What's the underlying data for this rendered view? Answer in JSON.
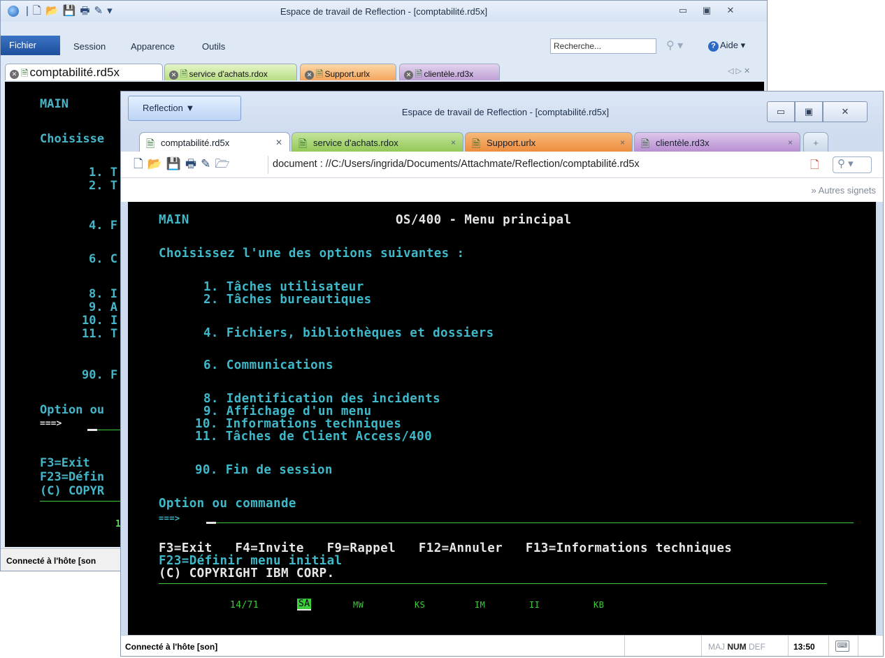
{
  "back": {
    "title": "Espace de travail de Reflection - [comptabilité.rd5x]",
    "menu": {
      "fichier": "Fichier",
      "session": "Session",
      "apparence": "Apparence",
      "outils": "Outils"
    },
    "search_placeholder": "Recherche...",
    "help": "Aide",
    "tabs": [
      "comptabilité.rd5x",
      "service d'achats.rdox",
      "Support.urlx",
      "clientèle.rd3x"
    ],
    "terminal": {
      "main": "MAIN",
      "choose": "Choisisse",
      "opt1": "1. T",
      "opt2": "2. T",
      "opt4": "4. F",
      "opt6": "6. C",
      "opt8": "8. I",
      "opt9": "9. A",
      "opt10": "10. I",
      "opt11": "11. T",
      "opt90": "90. F",
      "option": "Option ou",
      "prompt": "===>",
      "f3": "F3=Exit",
      "f23": "F23=Défin",
      "copyright": "(C) COPYR",
      "status_frag": "1"
    },
    "status": "Connecté à l'hôte [son"
  },
  "front": {
    "app_button": "Reflection",
    "title": "Espace de travail de Reflection - [comptabilité.rd5x]",
    "tabs": [
      "comptabilité.rd5x",
      "service d'achats.rdox",
      "Support.urlx",
      "clientèle.rd3x"
    ],
    "address": "document : //C:/Users/ingrida/Documents/Attachmate/Reflection/comptabilité.rd5x",
    "bookmarks": "Autres signets",
    "terminal": {
      "main": "MAIN",
      "heading": "OS/400 - Menu principal",
      "choose": "Choisissez l'une des options suivantes :",
      "opt1": "1. Tâches utilisateur",
      "opt2": "2. Tâches bureautiques",
      "opt4": "4. Fichiers, bibliothèques et dossiers",
      "opt6": "6. Communications",
      "opt8": "8. Identification des incidents",
      "opt9": "9. Affichage d'un menu",
      "opt10": "10. Informations techniques",
      "opt11": "11. Tâches de Client Access/400",
      "opt90": "90. Fin de session",
      "option": "Option ou commande",
      "prompt": "===>",
      "fkeys": "F3=Exit   F4=Invite   F9=Rappel   F12=Annuler   F13=Informations techniques",
      "f23": "F23=Définir menu initial",
      "copyright": "(C) COPYRIGHT IBM CORP.",
      "oia_pos": "14/71",
      "oia_sa": "SA",
      "oia_mw": "MW",
      "oia_ks": "KS",
      "oia_im": "IM",
      "oia_ii": "II",
      "oia_kb": "KB"
    },
    "status": "Connecté à l'hôte [son]",
    "caps_maj": "MAJ",
    "caps_num": "NUM",
    "caps_def": "DEF",
    "time": "13:50"
  }
}
